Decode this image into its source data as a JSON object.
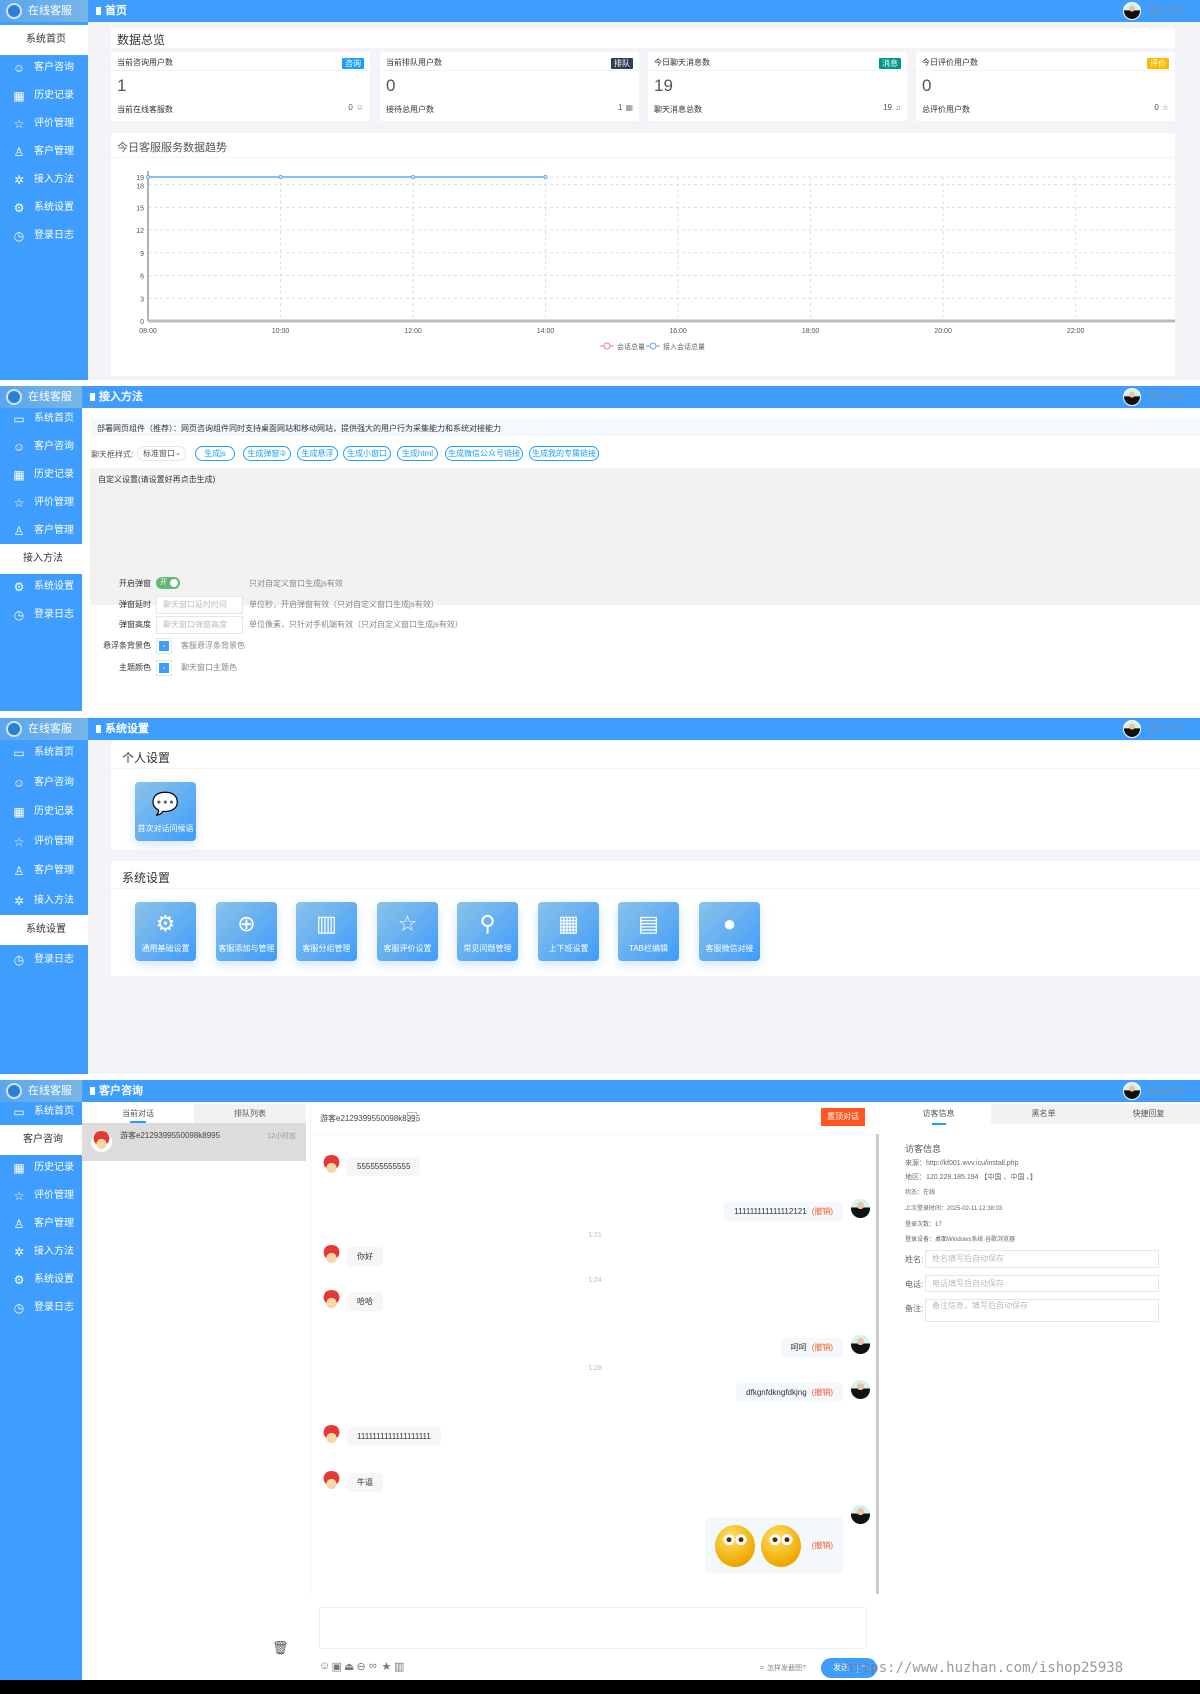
{
  "app": {
    "logo_text": "在线客服",
    "user_status": "客服 在线"
  },
  "sidebar_items": [
    {
      "label": "系统首页",
      "icon": "window-icon"
    },
    {
      "label": "客户咨询",
      "icon": "smile-icon"
    },
    {
      "label": "历史记录",
      "icon": "calendar-icon"
    },
    {
      "label": "评价管理",
      "icon": "star-icon"
    },
    {
      "label": "客户管理",
      "icon": "user-icon"
    },
    {
      "label": "接入方法",
      "icon": "puzzle-icon"
    },
    {
      "label": "系统设置",
      "icon": "gear-icon"
    },
    {
      "label": "登录日志",
      "icon": "clock-icon"
    }
  ],
  "home": {
    "title": "首页",
    "active": 0,
    "overview_title": "数据总览",
    "stats": [
      {
        "label": "当前咨询用户数",
        "badge": "咨询",
        "badge_color": "#1e9fff",
        "value": "1",
        "sub_label": "当前在线客服数",
        "sub_value": "0",
        "icon": "headset-icon"
      },
      {
        "label": "当前排队用户数",
        "badge": "排队",
        "badge_color": "#2f4056",
        "value": "0",
        "sub_label": "接待总用户数",
        "sub_value": "1",
        "icon": "grid-icon"
      },
      {
        "label": "今日聊天消息数",
        "badge": "消息",
        "badge_color": "#009688",
        "value": "19",
        "sub_label": "聊天消息总数",
        "sub_value": "19",
        "icon": "bell-icon"
      },
      {
        "label": "今日评价用户数",
        "badge": "评价",
        "badge_color": "#ffb800",
        "value": "0",
        "sub_label": "总评价用户数",
        "sub_value": "0",
        "icon": "star-icon"
      }
    ],
    "chart_title": "今日客服服务数据趋势"
  },
  "chart_data": {
    "type": "line",
    "title": "今日客服服务数据趋势",
    "x_ticks": [
      "08:00",
      "10:00",
      "12:00",
      "14:00",
      "16:00",
      "18:00",
      "20:00",
      "22:00"
    ],
    "y_ticks": [
      0,
      3,
      6,
      9,
      12,
      15,
      18,
      19
    ],
    "ylim": [
      0,
      19
    ],
    "grid": true,
    "legend": "bottom",
    "series": [
      {
        "name": "会话总量",
        "color": "#f08080",
        "x": [],
        "values": []
      },
      {
        "name": "接入会话总量",
        "color": "#5aa8f0",
        "x": [
          "08:00",
          "10:00",
          "12:00",
          "14:00"
        ],
        "values": [
          19,
          19,
          19,
          19
        ]
      }
    ]
  },
  "access": {
    "title": "接入方法",
    "active": 5,
    "info": "部署网页组件（推荐）：网页咨询组件同时支持桌面网站和移动网站，提供强大的用户行为采集能力和系统对接能力",
    "style_label": "聊天框样式:",
    "style_value": "标准窗口",
    "buttons": [
      "生成js",
      "生成弹窗②",
      "生成悬浮",
      "生成小窗口",
      "生成html",
      "生成微信公众号链接",
      "生成我的专属链接"
    ],
    "custom_title": "自定义设置(请设置好再点击生成)",
    "rows": [
      {
        "label": "开启弹窗",
        "toggle": "开",
        "hint": "只对自定义窗口生成js有效"
      },
      {
        "label": "弹窗延时",
        "placeholder": "聊天窗口延时时间",
        "hint": "单位秒，开启弹窗有效（只对自定义窗口生成js有效）"
      },
      {
        "label": "弹窗高度",
        "placeholder": "聊天窗口弹窗高度",
        "hint": "单位像素，只针对手机端有效（只对自定义窗口生成js有效）"
      },
      {
        "label": "悬浮条背景色",
        "hint": "客服悬浮条背景色"
      },
      {
        "label": "主题颜色",
        "hint": "聊天窗口主题色"
      }
    ],
    "toggle_on": true,
    "picker_color": "#3f9dfd"
  },
  "settings": {
    "title": "系统设置",
    "active": 6,
    "personal_title": "个人设置",
    "personal_tiles": [
      {
        "label": "首次对话问候语",
        "icon": "chat-bubbles-icon"
      }
    ],
    "system_title": "系统设置",
    "system_tiles": [
      {
        "label": "通用基础设置",
        "icon": "gear-icon"
      },
      {
        "label": "客服添加与管理",
        "icon": "plus-circle-icon"
      },
      {
        "label": "客服分组管理",
        "icon": "group-icon"
      },
      {
        "label": "客服评价设置",
        "icon": "star-icon"
      },
      {
        "label": "常见问题管理",
        "icon": "search-icon"
      },
      {
        "label": "上下班设置",
        "icon": "calendar-icon"
      },
      {
        "label": "TAB栏编辑",
        "icon": "browser-window-icon"
      },
      {
        "label": "客服微信对接",
        "icon": "wechat-icon"
      }
    ]
  },
  "chat": {
    "title": "客户咨询",
    "active": 1,
    "list_tabs": [
      "当前对话",
      "排队列表"
    ],
    "conversations": [
      {
        "name": "游客e2129399550098k8995",
        "time": "12小时前"
      }
    ],
    "chat_title": "游客e2129399550098k8995",
    "pin_button": "置顶对话",
    "messages": [
      {
        "from": "visitor",
        "text": "555555555555"
      },
      {
        "from": "agent",
        "text": "111111111111112121",
        "recall": "(撤销)"
      },
      {
        "from": "time",
        "text": "1:21"
      },
      {
        "from": "visitor",
        "text": "你好"
      },
      {
        "from": "time",
        "text": "1:24"
      },
      {
        "from": "visitor",
        "text": "哈哈"
      },
      {
        "from": "agent",
        "text": "呵呵",
        "recall": "(撤销)"
      },
      {
        "from": "time",
        "text": "1:28"
      },
      {
        "from": "agent",
        "text": "dfkgnfdkngfdkjng",
        "recall": "(撤销)"
      },
      {
        "from": "visitor",
        "text": "1111111111111111111"
      },
      {
        "from": "visitor",
        "text": "牛逼"
      },
      {
        "from": "agent-emoji",
        "text": "",
        "emoji_count": 2,
        "recall": "(撤销)"
      }
    ],
    "screenshot_help": "怎样发截图?",
    "send_label": "发送",
    "right_tabs": [
      "访客信息",
      "黑名单",
      "快捷回复"
    ],
    "visitor_info_title": "访客信息",
    "visitor_info": [
      "来源：http://kf001.wvv.icu/install.php",
      "地区：120.229.185.194 【中国 、中国 、】",
      "状态：在线",
      "上次登录时间：2025-02-11 12:38:03",
      "登录次数：17",
      "登录设备：桌面Windows系统 谷歌浏览器"
    ],
    "fields": [
      {
        "label": "姓名:",
        "placeholder": "姓名填写后自动保存"
      },
      {
        "label": "电话:",
        "placeholder": "电话填写后自动保存"
      },
      {
        "label": "备注:",
        "placeholder": "备注信息，填写后自动保存"
      }
    ]
  },
  "watermark": "https://www.huzhan.com/ishop25938"
}
